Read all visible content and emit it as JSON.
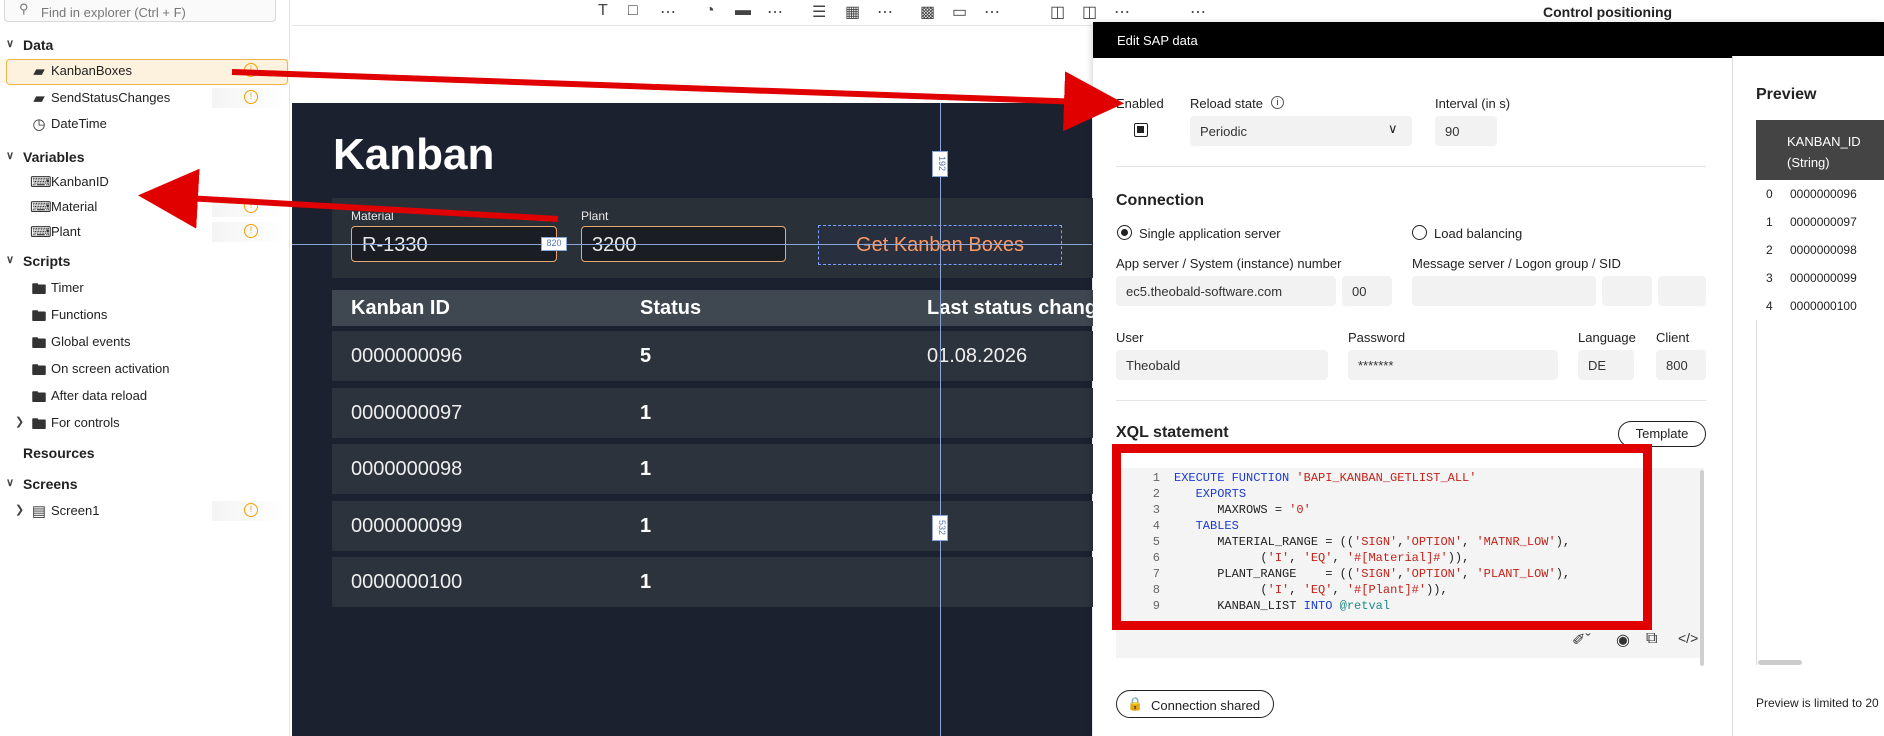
{
  "explorer": {
    "search_placeholder": "Find in explorer (Ctrl + F)",
    "data_header": "Data",
    "data_items": [
      "KanbanBoxes",
      "SendStatusChanges",
      "DateTime"
    ],
    "variables_header": "Variables",
    "variable_items": [
      "KanbanID",
      "Material",
      "Plant"
    ],
    "scripts_header": "Scripts",
    "script_items": [
      "Timer",
      "Functions",
      "Global events",
      "On screen activation",
      "After data reload",
      "For controls"
    ],
    "resources_header": "Resources",
    "screens_header": "Screens",
    "screen_items": [
      "Screen1"
    ]
  },
  "toolbar": {
    "right_title": "Control positioning"
  },
  "canvas": {
    "title": "Kanban",
    "material_label": "Material",
    "material_value": "R-1330",
    "plant_label": "Plant",
    "plant_value": "3200",
    "button_label": "Get Kanban Boxes",
    "col_kanban": "Kanban ID",
    "col_status": "Status",
    "col_last": "Last status chang",
    "rows": [
      {
        "id": "0000000096",
        "status": "5",
        "last": "01.08.2026"
      },
      {
        "id": "0000000097",
        "status": "1",
        "last": ""
      },
      {
        "id": "0000000098",
        "status": "1",
        "last": ""
      },
      {
        "id": "0000000099",
        "status": "1",
        "last": ""
      },
      {
        "id": "0000000100",
        "status": "1",
        "last": ""
      }
    ],
    "guide_top": "192",
    "guide_mid": "532",
    "guide_right": "820"
  },
  "edit_panel": {
    "title": "Edit SAP data",
    "enabled_label": "Enabled",
    "reload_label": "Reload state",
    "reload_value": "Periodic",
    "interval_label": "Interval (in s)",
    "interval_value": "90",
    "connection_header": "Connection",
    "single_server": "Single application server",
    "load_balancing": "Load balancing",
    "app_server_label": "App server / System (instance) number",
    "app_server_value": "ec5.theobald-software.com",
    "instance_value": "00",
    "message_server_label": "Message server / Logon group / SID",
    "user_label": "User",
    "user_value": "Theobald",
    "password_label": "Password",
    "password_value": "*******",
    "language_label": "Language",
    "language_value": "DE",
    "client_label": "Client",
    "client_value": "800",
    "xql_header": "XQL statement",
    "template_button": "Template",
    "connection_shared": "Connection shared",
    "code_lines": [
      "EXECUTE FUNCTION 'BAPI_KANBAN_GETLIST_ALL'",
      "   EXPORTS",
      "      MAXROWS = '0'",
      "   TABLES",
      "      MATERIAL_RANGE = (('SIGN','OPTION', 'MATNR_LOW'),",
      "            ('I', 'EQ', '#[Material]#')),",
      "      PLANT_RANGE    = (('SIGN','OPTION', 'PLANT_LOW'),",
      "            ('I', 'EQ', '#[Plant]#')),",
      "      KANBAN_LIST INTO @retval"
    ]
  },
  "preview": {
    "title": "Preview",
    "col_header": "KANBAN_ID",
    "col_type": "(String)",
    "rows": [
      {
        "idx": "0",
        "val": "0000000096"
      },
      {
        "idx": "1",
        "val": "0000000097"
      },
      {
        "idx": "2",
        "val": "0000000098"
      },
      {
        "idx": "3",
        "val": "0000000099"
      },
      {
        "idx": "4",
        "val": "0000000100"
      }
    ],
    "footer": "Preview is limited to 20"
  },
  "colors": {
    "accent_orange": "#f0a000",
    "arrow_red": "#e00000",
    "canvas_bg": "#1c2130"
  }
}
